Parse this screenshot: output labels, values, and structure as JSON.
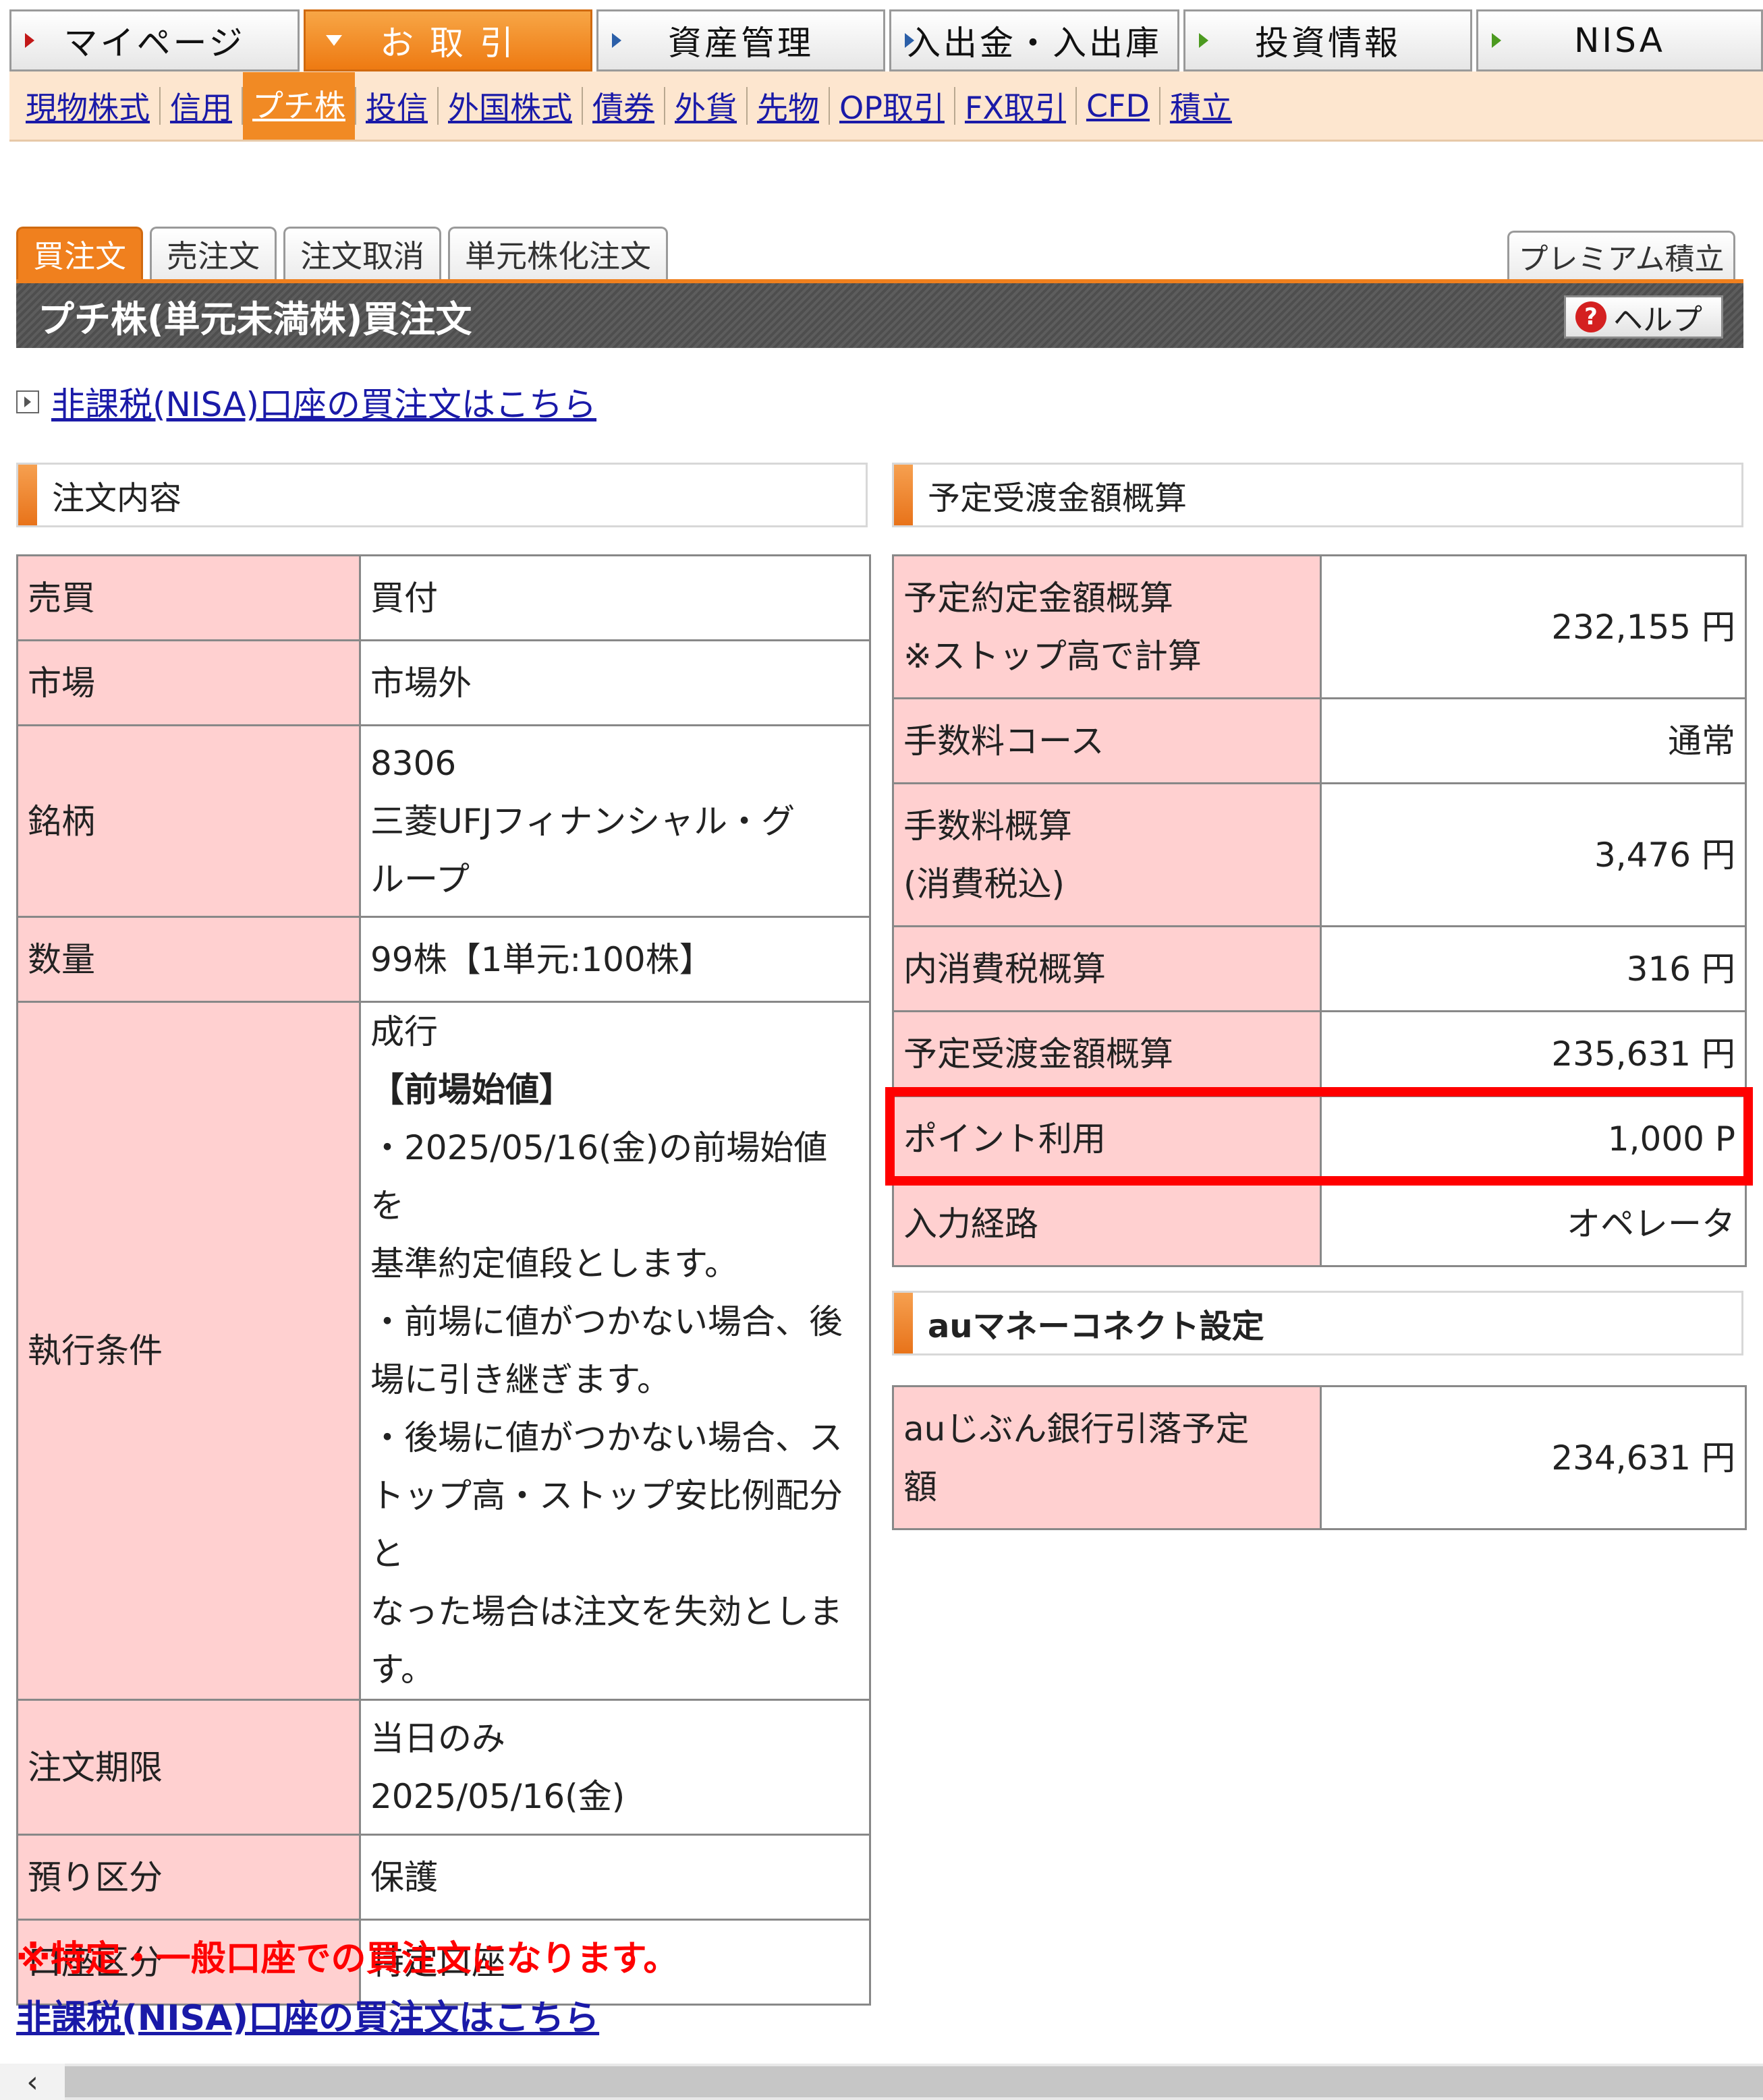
{
  "main_nav": [
    {
      "label": "マイページ"
    },
    {
      "label": "お 取 引"
    },
    {
      "label": "資産管理"
    },
    {
      "label": "入出金・入出庫"
    },
    {
      "label": "投資情報"
    },
    {
      "label": "NISA"
    }
  ],
  "sub_nav": [
    "現物株式",
    "信用",
    "プチ株",
    "投信",
    "外国株式",
    "債券",
    "外貨",
    "先物",
    "OP取引",
    "FX取引",
    "CFD",
    "積立"
  ],
  "order_tabs": [
    "買注文",
    "売注文",
    "注文取消",
    "単元株化注文"
  ],
  "premium_tab": "プレミアム積立",
  "page_title": "プチ株(単元未満株)買注文",
  "help_label": "ヘルプ",
  "help_icon_glyph": "?",
  "nisa_link": "非課税(NISA)口座の買注文はこちら",
  "order_section": {
    "title": "注文内容",
    "rows": {
      "side": {
        "label": "売買",
        "value": "買付"
      },
      "market": {
        "label": "市場",
        "value": "市場外"
      },
      "stock": {
        "label": "銘柄",
        "code": "8306",
        "name1": "三菱UFJフィナンシャル・グ",
        "name2": "ループ"
      },
      "quantity": {
        "label": "数量",
        "value": "99株【1単元:100株】"
      },
      "execution": {
        "label": "執行条件",
        "line1": "成行",
        "line2": "【前場始値】",
        "line3": "・2025/05/16(金)の前場始値を",
        "line4": "基準約定値段とします。",
        "line5": "・前場に値がつかない場合、後",
        "line6": "場に引き継ぎます。",
        "line7": "・後場に値がつかない場合、ス",
        "line8": "トップ高・ストップ安比例配分と",
        "line9": "なった場合は注文を失効としま",
        "line10": "す。"
      },
      "period": {
        "label": "注文期限",
        "line1": "当日のみ",
        "line2": "2025/05/16(金)"
      },
      "custody": {
        "label": "預り区分",
        "value": "保護"
      },
      "account": {
        "label": "口座区分",
        "value": "特定口座"
      }
    }
  },
  "settlement_section": {
    "title": "予定受渡金額概算",
    "rows": {
      "contract": {
        "label1": "予定約定金額概算",
        "label2": "※ストップ高で計算",
        "value": "232,155 円"
      },
      "fee_course": {
        "label": "手数料コース",
        "value": "通常"
      },
      "fee": {
        "label1": "手数料概算",
        "label2": "(消費税込)",
        "value": "3,476 円"
      },
      "tax": {
        "label": "内消費税概算",
        "value": "316 円"
      },
      "settlement": {
        "label": "予定受渡金額概算",
        "value": "235,631 円"
      },
      "points": {
        "label": "ポイント利用",
        "value": "1,000 P"
      },
      "route": {
        "label": "入力経路",
        "value": "オペレータ"
      }
    }
  },
  "au_section": {
    "title": "auマネーコネクト設定",
    "row": {
      "label1": "auじぶん銀行引落予定",
      "label2": "額",
      "value": "234,631 円"
    }
  },
  "tax_note": "※特定・一般口座での買注文になります。",
  "nisa_link_bottom": "非課税(NISA)口座の買注文はこちら",
  "scroll_left_glyph": "‹",
  "colors": {
    "accent_orange": "#f0801e",
    "header_pink": "#ffd0d0",
    "highlight_red": "#ff0000",
    "link_blue": "#1a1aa8"
  }
}
